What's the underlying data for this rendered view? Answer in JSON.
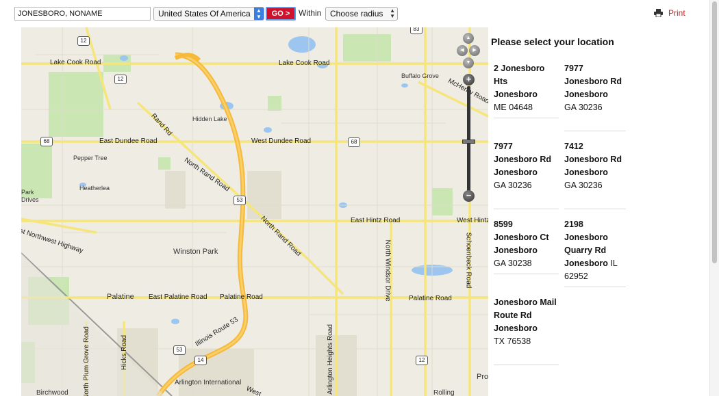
{
  "search": {
    "location_value": "JONESBORO, NONAME",
    "country_selected": "United States Of America",
    "go_label": "GO >",
    "within_label": "Within",
    "radius_selected": "Choose radius"
  },
  "print_label": "Print",
  "results": {
    "title": "Please select your location",
    "items": [
      {
        "street": "2 Jonesboro Hts",
        "city": "Jonesboro",
        "state": "ME 04648"
      },
      {
        "street": "7977 Jonesboro Rd",
        "city": "Jonesboro",
        "state": "GA 30236"
      },
      {
        "street": "7977 Jonesboro Rd",
        "city": "Jonesboro",
        "state": "GA 30236"
      },
      {
        "street": "7412 Jonesboro Rd",
        "city": "Jonesboro",
        "state": "GA 30236"
      },
      {
        "street": "8599 Jonesboro Ct",
        "city": "Jonesboro",
        "state": "GA 30238"
      },
      {
        "street": "2198 Jonesboro Quarry Rd",
        "city": "Jonesboro",
        "state": "IL 62952"
      },
      {
        "street": "Jonesboro Mail Route Rd",
        "city": "Jonesboro",
        "state": "TX 76538"
      }
    ]
  },
  "map": {
    "labels": {
      "lake_cook_w": "Lake Cook Road",
      "lake_cook_e": "Lake Cook Road",
      "buffalo_grove": "Buffalo Grove",
      "mchenry": "McHenry Road",
      "hidden_lake": "Hidden Lake",
      "rand_road": "Rand Rd",
      "east_dundee": "East Dundee Road",
      "west_dundee": "West Dundee Road",
      "pepper_tree": "Pepper Tree",
      "heatherlea": "Heatherlea",
      "park": "Park",
      "drives": "Drives",
      "north_rand_1": "North Rand Road",
      "north_rand_2": "North Rand Road",
      "nw_highway": "st Northwest Highway",
      "east_hintz": "East Hintz Road",
      "west_hintz": "West Hintz",
      "winston_park": "Winston Park",
      "north_windsor": "North Windsor Drive",
      "schoenbeck": "Schoenbeck Road",
      "palatine": "Palatine",
      "east_palatine": "East Palatine Road",
      "palatine_road": "Palatine Road",
      "palatine_road_e": "Palatine Road",
      "illinois_53": "Illinois Route 53",
      "plum_grove": "North Plum Grove Road",
      "hicks": "Hicks Road",
      "arlington": "Arlington International",
      "arlington_heights": "Arlington Heights Road",
      "birchwood": "Birchwood",
      "rolling": "Rolling",
      "west_bottom": "West",
      "pro": "Pro"
    },
    "shields": [
      "12",
      "12",
      "83",
      "68",
      "68",
      "53",
      "53",
      "14",
      "12"
    ],
    "zoom_in": "+",
    "zoom_out": "−"
  }
}
